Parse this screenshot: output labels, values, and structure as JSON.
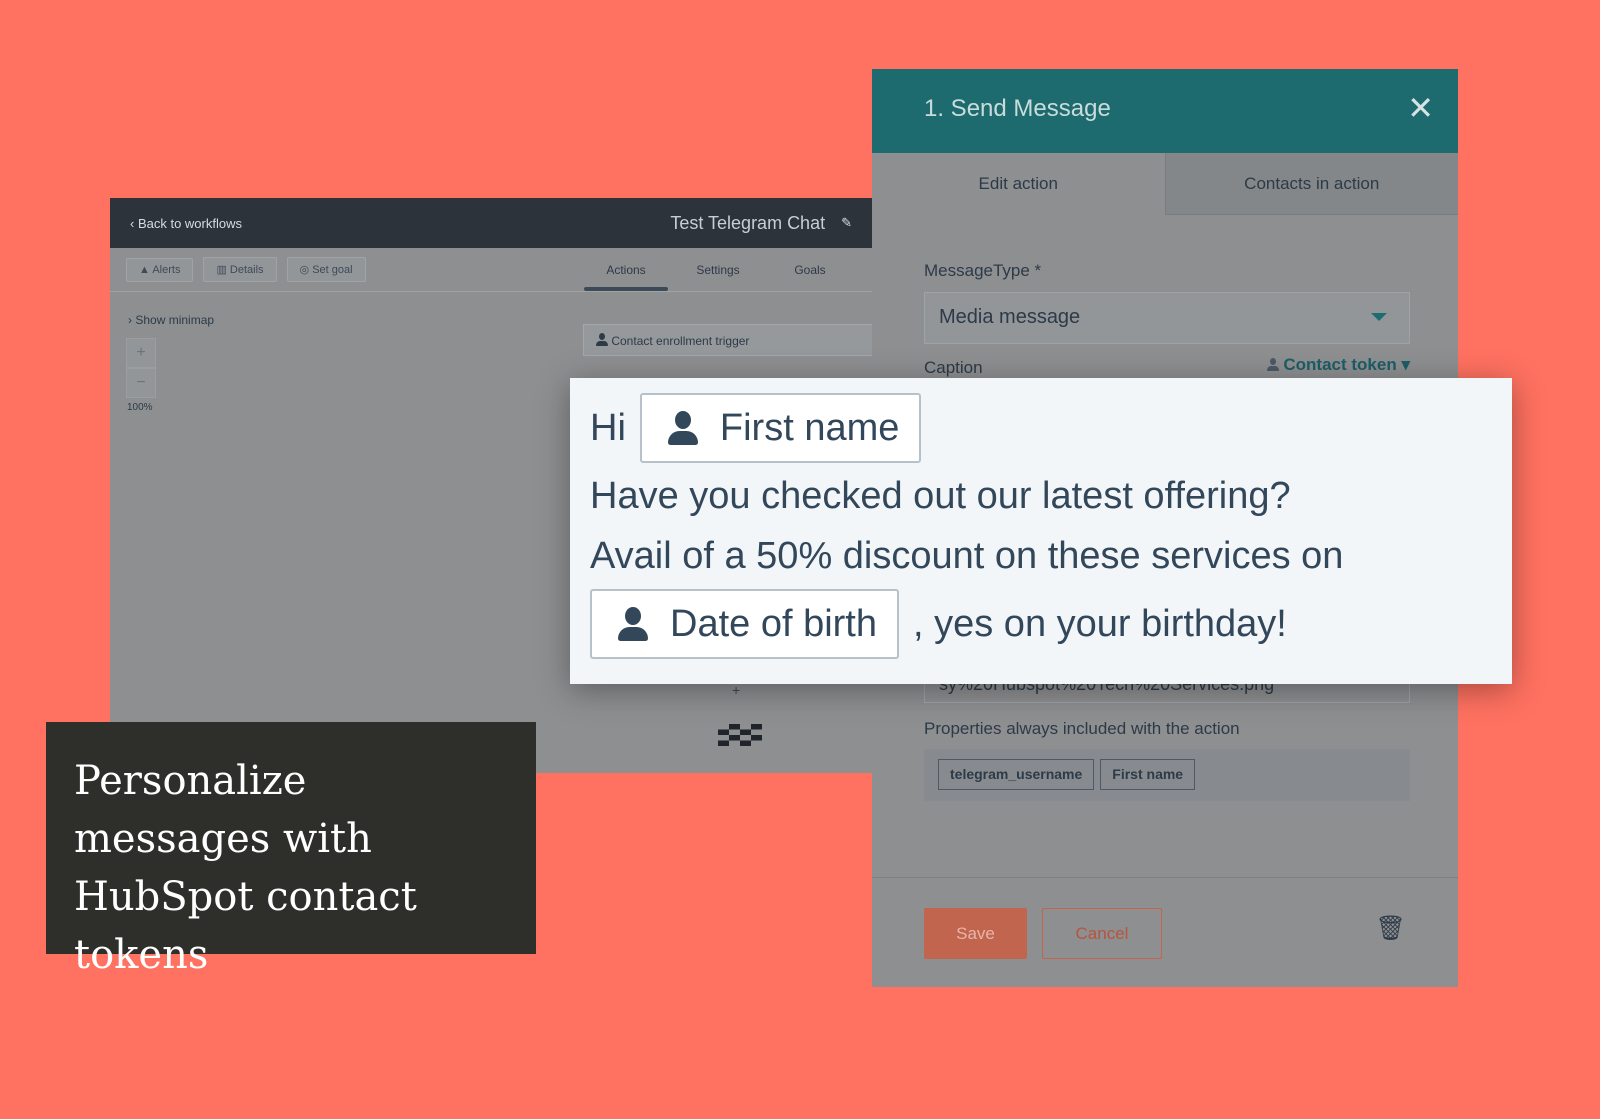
{
  "workflow": {
    "back_label": "Back to workflows",
    "title": "Test Telegram Chat",
    "buttons": [
      "Alerts",
      "Details",
      "Set goal"
    ],
    "tabs": [
      "Actions",
      "Settings",
      "Goals"
    ],
    "active_tab": "Actions",
    "show_minimap": "Show minimap",
    "zoom_level": "100%",
    "trigger": "Contact enrollment trigger"
  },
  "caption": "Personalize messages with HubSpot contact tokens",
  "panel": {
    "title": "1. Send Message",
    "tabs": [
      "Edit action",
      "Contacts in action"
    ],
    "message_type_label": "MessageType *",
    "message_type_value": "Media message",
    "caption_label": "Caption",
    "contact_token": "Contact token",
    "url_value": "sy%20Hubspot%20Tech%20Services.png",
    "properties_label": "Properties always included with the action",
    "properties": [
      "telegram_username",
      "First name"
    ],
    "save": "Save",
    "cancel": "Cancel"
  },
  "overlay": {
    "greeting": "Hi",
    "token1": "First name",
    "line2": "Have you checked out our latest offering?",
    "line3": "Avail of a 50% discount on these services on",
    "token2": "Date of birth",
    "line4_suffix": ", yes on your birthday!"
  },
  "colors": {
    "background": "#ff7160",
    "panel_header": "#1d6b6e",
    "caption_bg": "#2e2e2b"
  }
}
